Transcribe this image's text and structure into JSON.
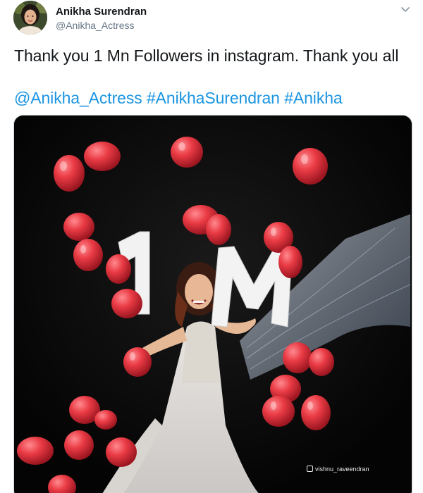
{
  "author": {
    "name": "Anikha Surendran",
    "handle": "@Anikha_Actress"
  },
  "tweet": {
    "text": "Thank you 1 Mn Followers in instagram. Thank you all",
    "tags": [
      "@Anikha_Actress",
      "#AnikhaSurendran",
      "#Anikha"
    ]
  },
  "media": {
    "watermark": "vishnu_raveendran",
    "props_text": "1M"
  },
  "icons": {
    "caret": "chevron-down-icon",
    "watermark": "instagram-icon"
  },
  "colors": {
    "link": "#1b95e0",
    "text": "#14171a",
    "muted": "#657786",
    "balloon": "#e8333b"
  }
}
